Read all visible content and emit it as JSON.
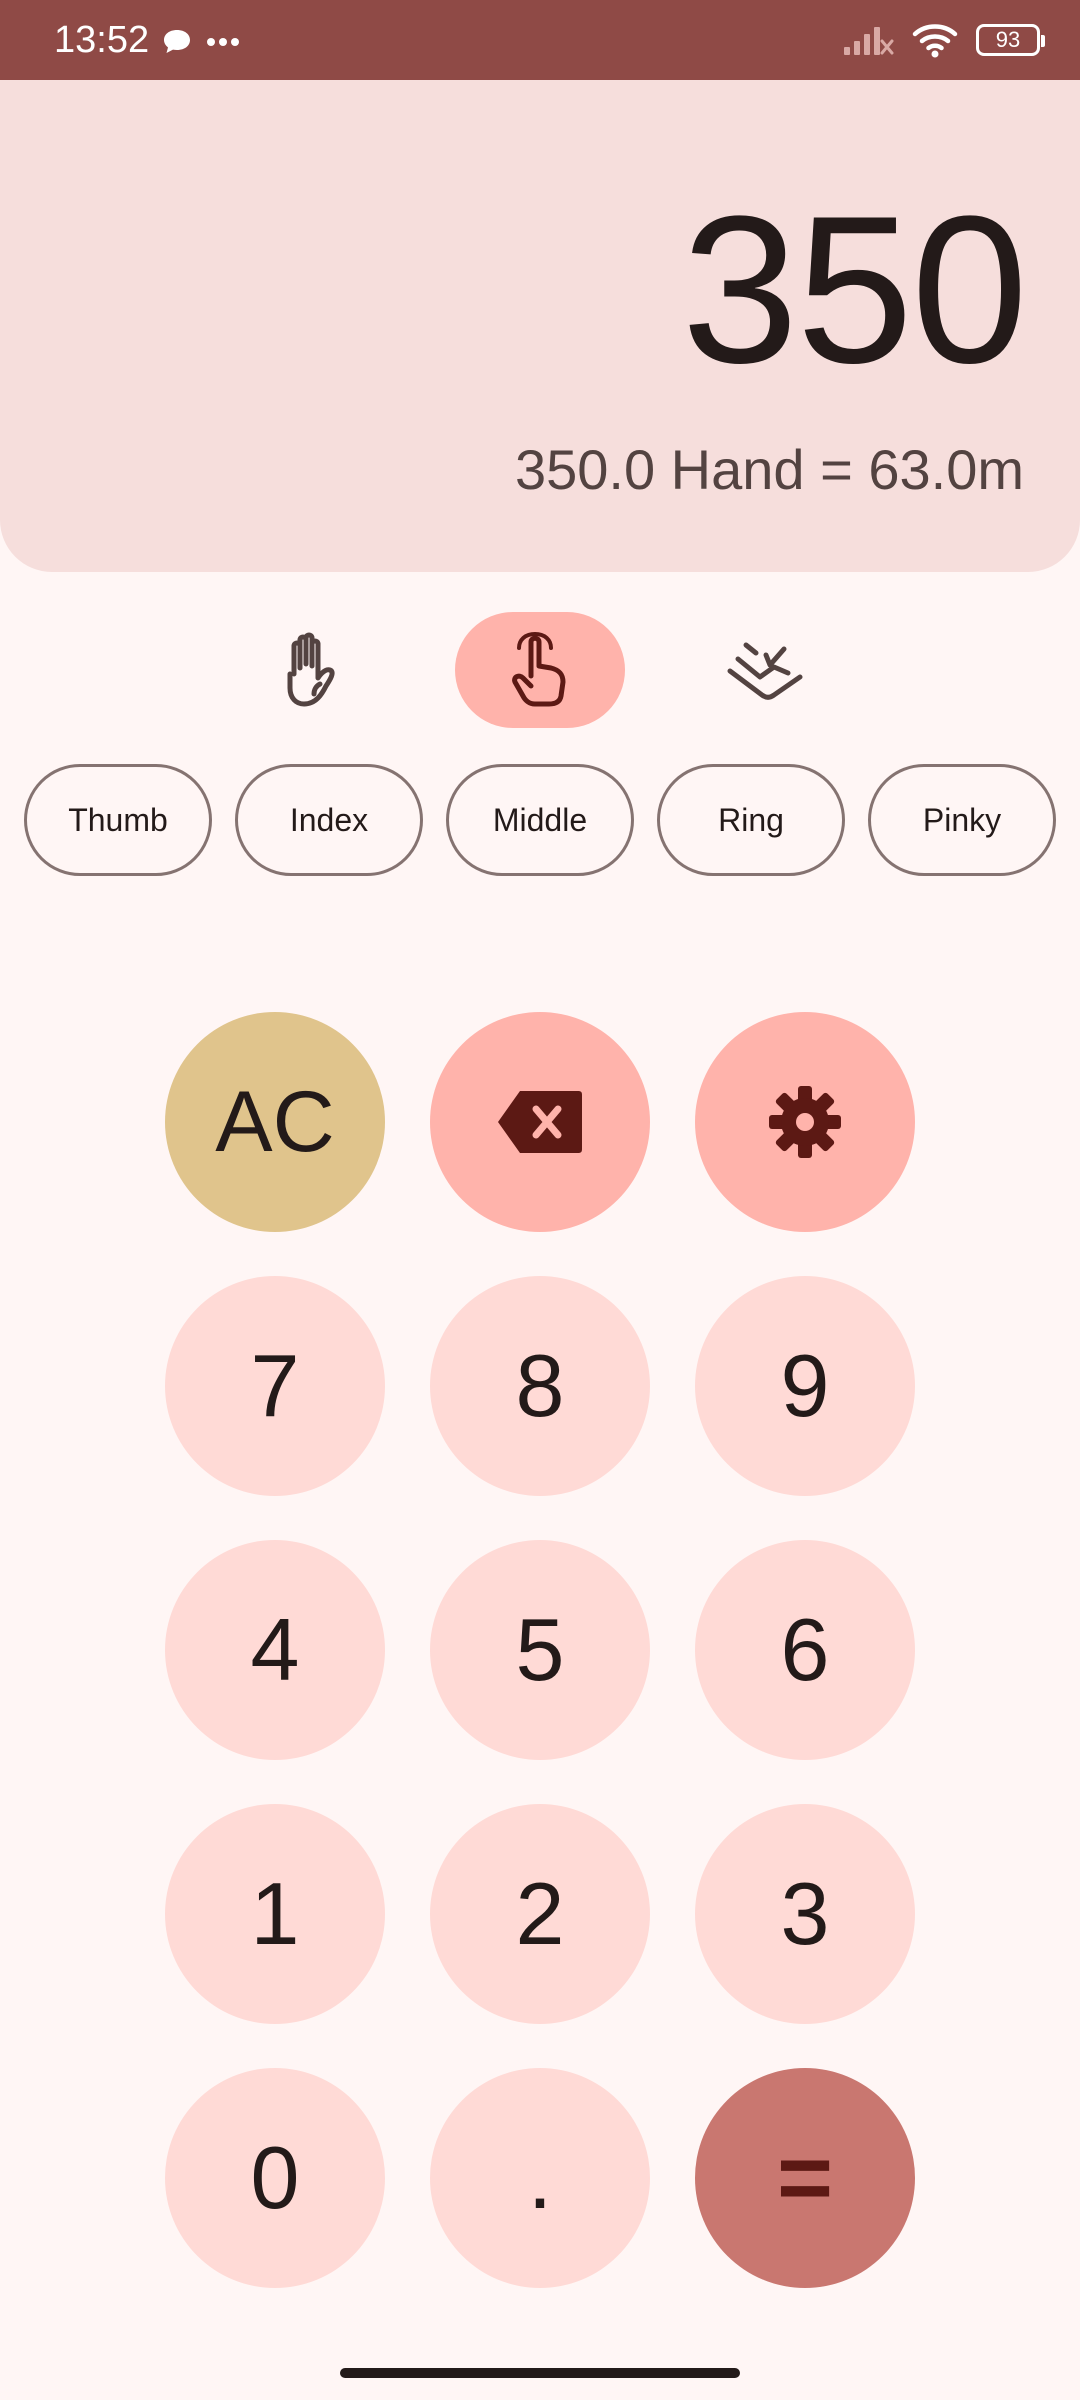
{
  "status_bar": {
    "time": "13:52",
    "battery": "93",
    "icons": [
      "chat-bubble-icon",
      "more-dots-icon",
      "signal-icon",
      "wifi-icon",
      "battery-icon"
    ]
  },
  "display": {
    "value": "350",
    "conversion": "350.0 Hand = 63.0m"
  },
  "modes": [
    {
      "name": "hand",
      "icon": "hand-icon",
      "active": false
    },
    {
      "name": "finger",
      "icon": "pointer-finger-icon",
      "active": true
    },
    {
      "name": "foot",
      "icon": "footprint-icon",
      "active": false
    }
  ],
  "chips": {
    "thumb": "Thumb",
    "index": "Index",
    "middle": "Middle",
    "ring": "Ring",
    "pinky": "Pinky"
  },
  "keys": {
    "ac": "AC",
    "seven": "7",
    "eight": "8",
    "nine": "9",
    "four": "4",
    "five": "5",
    "six": "6",
    "one": "1",
    "two": "2",
    "three": "3",
    "zero": "0",
    "dot": ".",
    "equals": "="
  },
  "colors": {
    "status_bar": "#8F4A46",
    "display_bg": "#F6DEDC",
    "key_bg": "#FFDAD6",
    "accent": "#FFB3AB",
    "ac": "#E0C48C",
    "equals": "#C97770"
  }
}
